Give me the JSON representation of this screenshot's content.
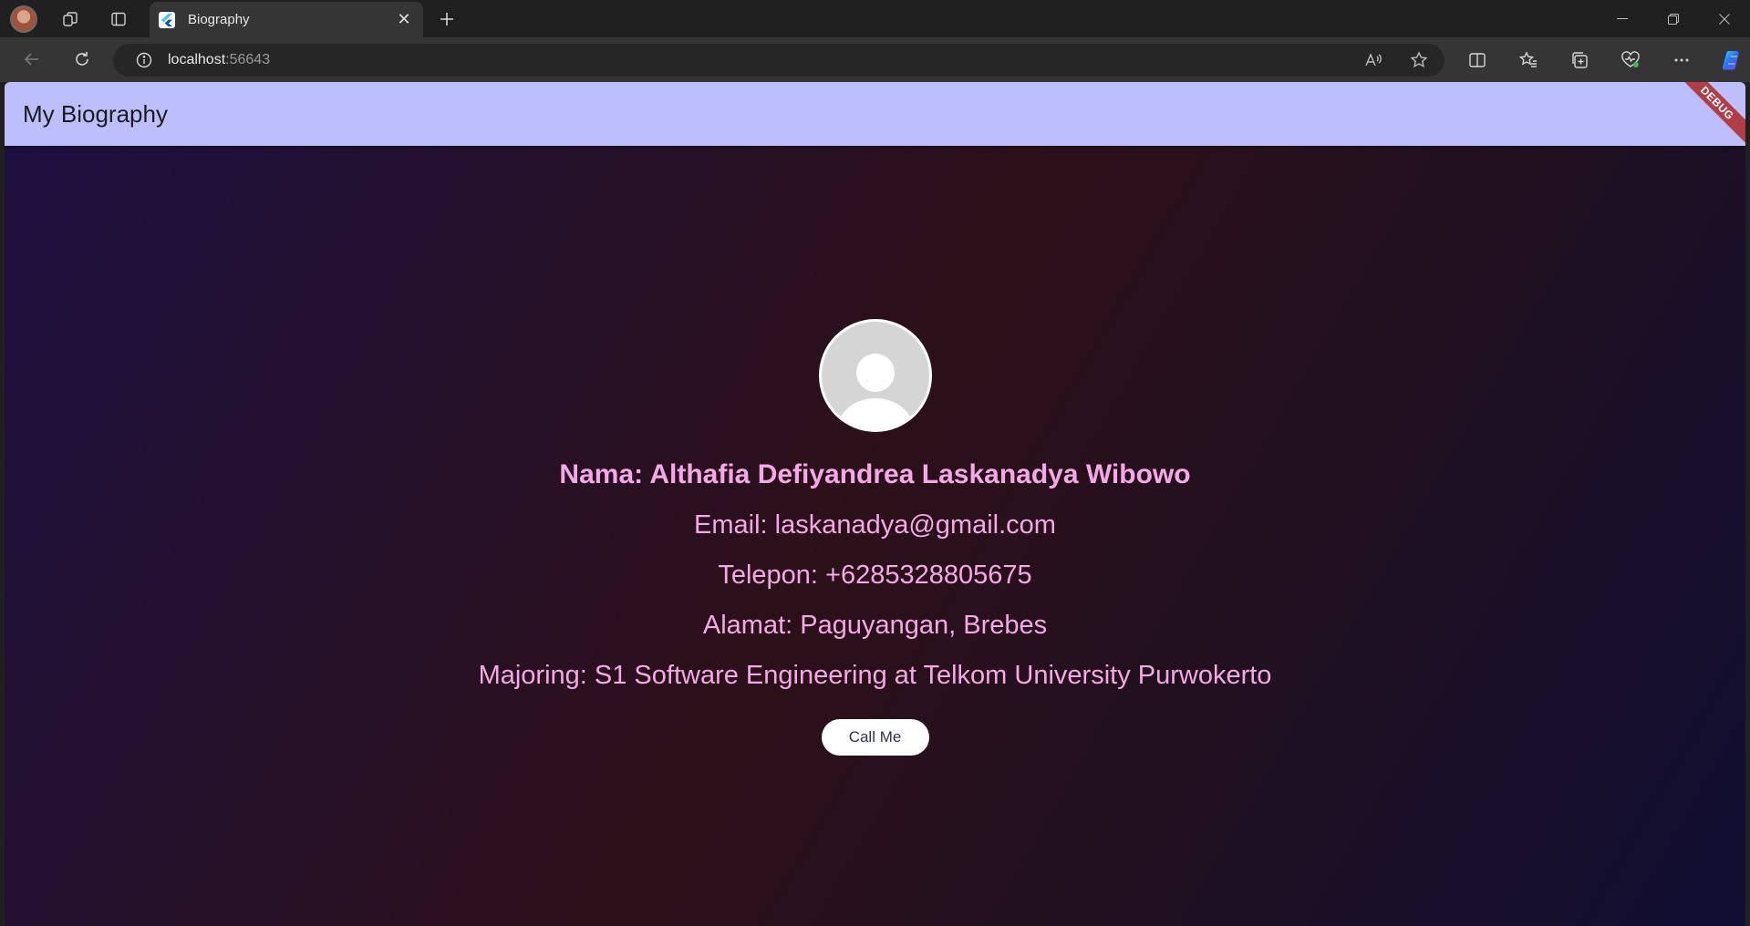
{
  "browser": {
    "tab_title": "Biography",
    "address_host": "localhost",
    "address_port": ":56643"
  },
  "app": {
    "title": "My Biography",
    "debug_label": "DEBUG"
  },
  "profile": {
    "name": "Nama: Althafia Defiyandrea Laskanadya Wibowo",
    "email": "Email: laskanadya@gmail.com",
    "phone": "Telepon: +6285328805675",
    "address": "Alamat: Paguyangan, Brebes",
    "major": "Majoring: S1 Software Engineering at Telkom University Purwokerto",
    "call_button": "Call Me"
  },
  "colors": {
    "appbar": "#bdbffc",
    "text_accent": "#f4a9e6",
    "debug_banner": "#b13d47"
  }
}
